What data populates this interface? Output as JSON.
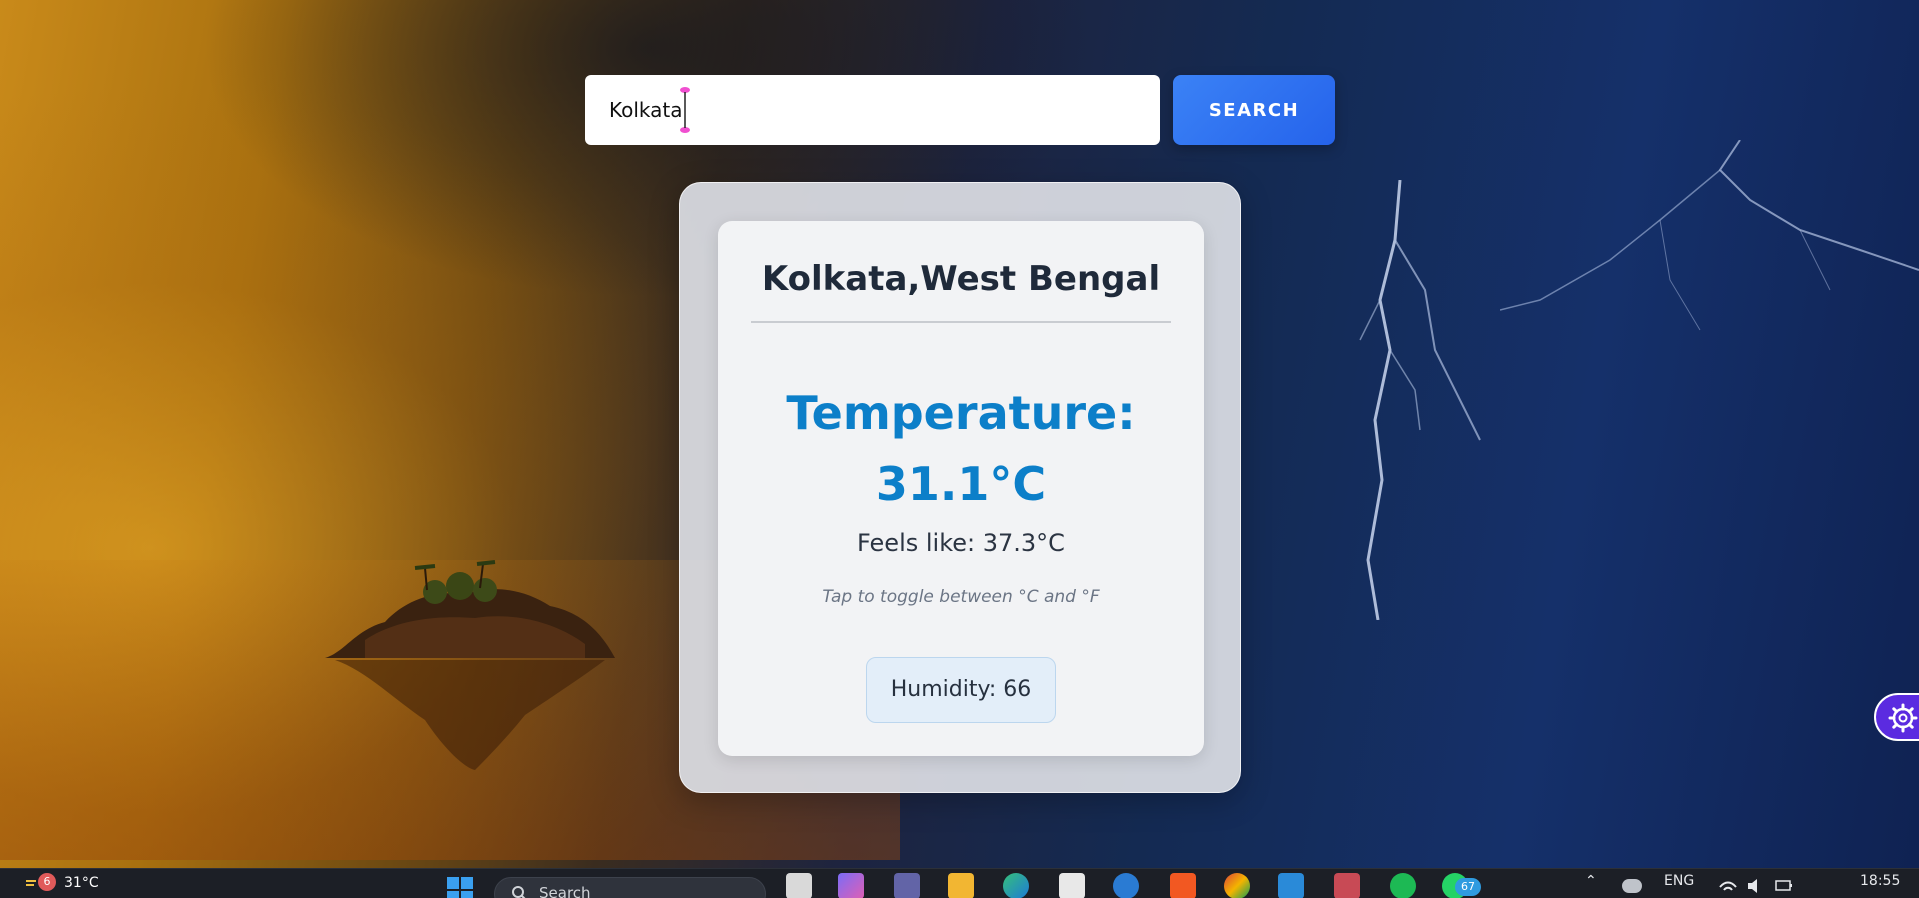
{
  "search": {
    "value": "Kolkata",
    "button_label": "SEARCH"
  },
  "weather": {
    "location": "Kolkata,West Bengal",
    "temperature_label": "Temperature:",
    "temperature_value": "31.1°C",
    "feels_like": "Feels like: 37.3°C",
    "toggle_hint": "Tap to toggle between °C and °F",
    "humidity": "Humidity: 66"
  },
  "taskbar": {
    "weather_widget": {
      "badge": "6",
      "temp": "31°C"
    },
    "search_label": "Search",
    "whatsapp_badge": "67",
    "language": "ENG",
    "time": "18:55"
  },
  "colors": {
    "accent": "#2563eb",
    "temperature": "#0c7fc9",
    "settings_fab": "#5b2be0"
  },
  "icons": [
    "settings-gear-icon",
    "windows-start-icon",
    "search-icon",
    "file-explorer-icon",
    "edge-icon",
    "store-icon",
    "brave-icon",
    "chrome-icon",
    "vscode-icon",
    "spotify-icon",
    "whatsapp-icon",
    "wifi-icon",
    "volume-icon",
    "battery-icon"
  ]
}
